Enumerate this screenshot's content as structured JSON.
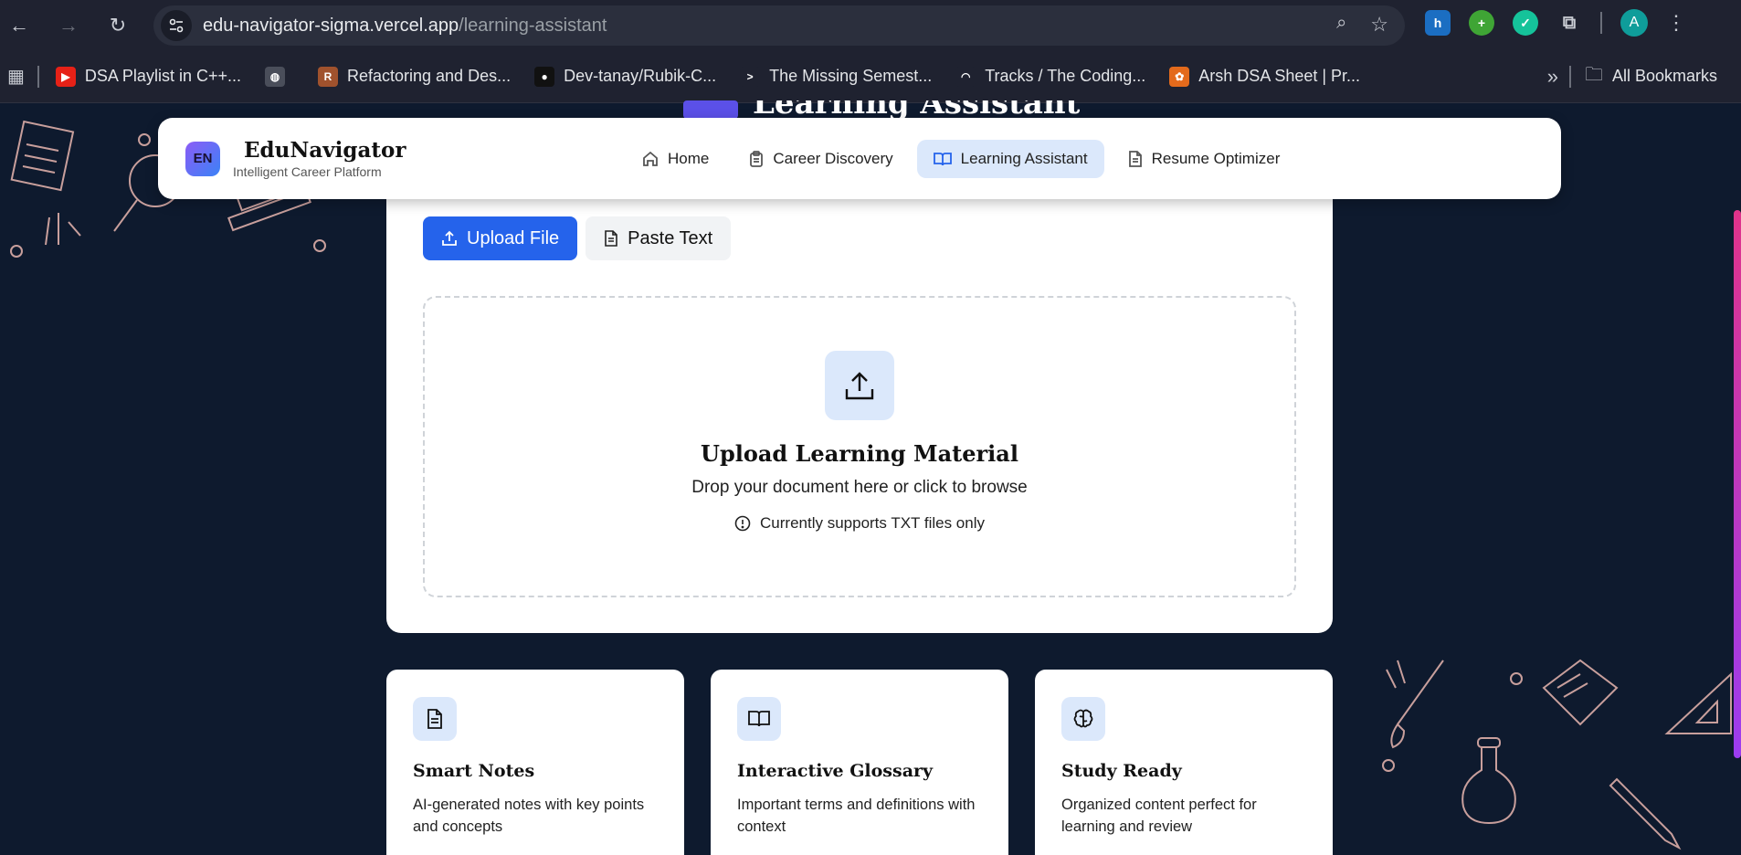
{
  "browser": {
    "url_host": "edu-navigator-sigma.vercel.app",
    "url_path": "/learning-assistant",
    "avatar_letter": "A",
    "bookmarks": [
      {
        "label": "DSA Playlist in C++...",
        "color": "#e62117",
        "glyph": "▶"
      },
      {
        "label": "",
        "color": "#4a4e5a",
        "glyph": "◍"
      },
      {
        "label": "Refactoring and Des...",
        "color": "#a0522d",
        "glyph": "R"
      },
      {
        "label": "Dev-tanay/Rubik-C...",
        "color": "#111111",
        "glyph": "●"
      },
      {
        "label": "The Missing Semest...",
        "color": "#1f2230",
        "glyph": ">"
      },
      {
        "label": "Tracks / The Coding...",
        "color": "#1f2230",
        "glyph": "◠"
      },
      {
        "label": "Arsh DSA Sheet | Pr...",
        "color": "#e36a1c",
        "glyph": "✿"
      }
    ],
    "all_bookmarks": "All Bookmarks"
  },
  "app": {
    "logo_text": "EN",
    "brand_name": "EduNavigator",
    "brand_tagline": "Intelligent Career Platform",
    "page_title": "Learning Assistant",
    "menu": [
      {
        "label": "Home",
        "icon": "home-icon"
      },
      {
        "label": "Career Discovery",
        "icon": "clipboard-icon"
      },
      {
        "label": "Learning Assistant",
        "icon": "book-open-icon",
        "active": true
      },
      {
        "label": "Resume Optimizer",
        "icon": "file-text-icon"
      }
    ]
  },
  "upload": {
    "tab_upload": "Upload File",
    "tab_paste": "Paste Text",
    "title": "Upload Learning Material",
    "subtitle": "Drop your document here or click to browse",
    "note": "Currently supports TXT files only"
  },
  "features": [
    {
      "title": "Smart Notes",
      "desc": "AI-generated notes with key points and concepts",
      "icon": "file-text-icon"
    },
    {
      "title": "Interactive Glossary",
      "desc": "Important terms and definitions with context",
      "icon": "book-open-icon"
    },
    {
      "title": "Study Ready",
      "desc": "Organized content perfect for learning and review",
      "icon": "brain-icon"
    }
  ],
  "colors": {
    "primary": "#2563eb",
    "page_bg": "#0e1a2e",
    "accent_light": "#dbe8fb"
  }
}
